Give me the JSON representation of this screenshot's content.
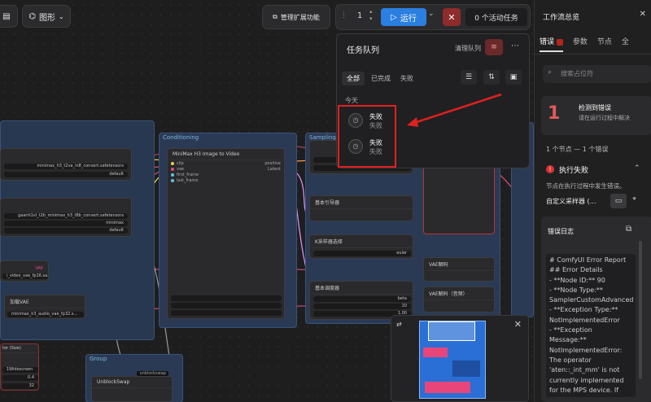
{
  "topbar": {
    "menu_label": "图形",
    "extensions_label": "管理扩展功能",
    "queue_count": "1",
    "run_label": "运行",
    "active_tasks_label": "0 个活动任务"
  },
  "queue": {
    "title": "任务队列",
    "clear_label": "清理队列",
    "tabs": [
      "全部",
      "已完成",
      "失败"
    ],
    "section_label": "今天",
    "items": [
      {
        "title": "失败",
        "status": "失败"
      },
      {
        "title": "失败",
        "status": "失败"
      }
    ]
  },
  "right_panel": {
    "title": "工作流总览",
    "tabs": [
      "错误",
      "参数",
      "节点",
      "全"
    ],
    "search_placeholder": "搜索占位符",
    "error_count": "1",
    "error_heading": "检测到错误",
    "error_desc": "请在运行过程中解决",
    "summary": "1 个节点 — 1 个错误",
    "exec_fail": "执行失败",
    "exec_desc": "节点在执行过程中发生错误。",
    "node_name": "自定义采样器 (…",
    "log_title": "错误日志",
    "log_lines": [
      "# ComfyUI Error Report",
      "## Error Details",
      "- **Node ID:** 90",
      "- **Node Type:**",
      "SamplerCustomAdvanced",
      "- **Exception Type:**",
      "NotImplementedError",
      "- **Exception",
      "Message:**",
      "NotImplementedError:",
      "The operator",
      "'aten::_int_mm' is not",
      "currently implemented",
      "for the MPS device. If"
    ]
  },
  "canvas": {
    "groups": [
      "Conditioning",
      "Sampling",
      "Group"
    ],
    "n_main": "MiniMax H3 Image to Video",
    "ports_main": [
      "clip",
      "vae",
      "first_frame",
      "last_frame"
    ],
    "out_main": [
      "positive",
      "Latent"
    ],
    "left1": [
      "minimax_h3_t2va_in8_convert.safetensors",
      "default"
    ],
    "left2": [
      "gaanh1vl_t2b_minimax_h3_t8b_convert.safetensors",
      "minimax",
      "default"
    ],
    "left3": "i_video_vae_fp16.sa…",
    "vae_label": "VAE",
    "audio_title": "加载VAE",
    "audio_file": "minimax_h3_audio_vae_fp32.s…",
    "sampler_a": "基本引导器",
    "sampler_b": "K采样器选择",
    "sampler_b_val": "euler",
    "sched_title": "基本调度器",
    "sched_vals": [
      "beta",
      "10",
      "1.00"
    ],
    "vae_decode": "VAE解码",
    "vae_decode2": "VAE解码（音频）",
    "size_title": "tor (Size)",
    "size_vals": [
      "1Widescreen",
      "0.4",
      "32"
    ],
    "swap_title": "UnblockSwap",
    "swap_tag": "unblockswap"
  }
}
